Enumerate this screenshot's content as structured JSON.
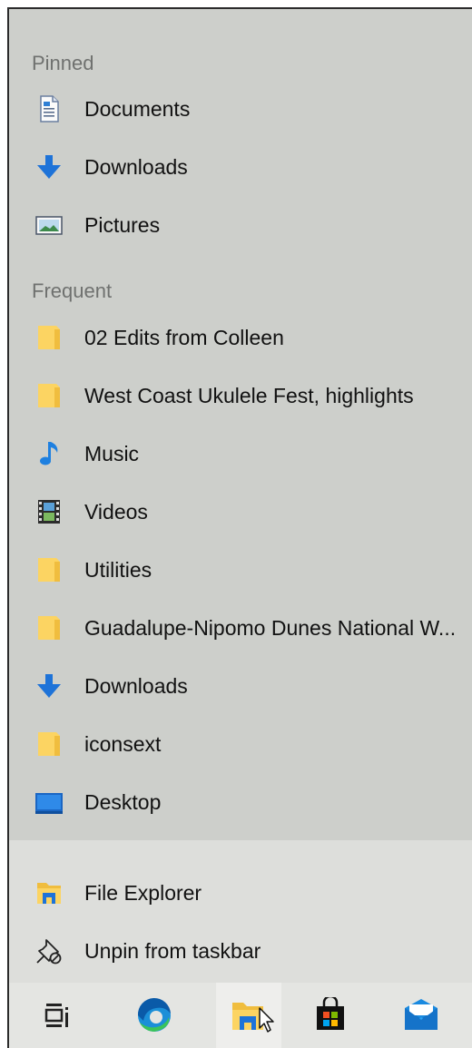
{
  "jumplist": {
    "pinned_header": "Pinned",
    "pinned": [
      {
        "label": "Documents",
        "icon": "documents-icon"
      },
      {
        "label": "Downloads",
        "icon": "downloads-icon"
      },
      {
        "label": "Pictures",
        "icon": "pictures-icon"
      }
    ],
    "frequent_header": "Frequent",
    "frequent": [
      {
        "label": "02 Edits from Colleen",
        "icon": "folder-icon"
      },
      {
        "label": "West Coast Ukulele Fest, highlights",
        "icon": "folder-icon"
      },
      {
        "label": "Music",
        "icon": "music-icon"
      },
      {
        "label": "Videos",
        "icon": "videos-icon"
      },
      {
        "label": "Utilities",
        "icon": "folder-icon"
      },
      {
        "label": "Guadalupe-Nipomo Dunes National W...",
        "icon": "folder-icon"
      },
      {
        "label": "Downloads",
        "icon": "downloads-icon"
      },
      {
        "label": "iconsext",
        "icon": "folder-icon"
      },
      {
        "label": "Desktop",
        "icon": "desktop-icon"
      }
    ],
    "tasks": [
      {
        "label": "File Explorer",
        "icon": "file-explorer-icon"
      },
      {
        "label": "Unpin from taskbar",
        "icon": "unpin-icon"
      }
    ]
  },
  "taskbar": {
    "buttons": [
      {
        "name": "task-view",
        "icon": "task-view-icon"
      },
      {
        "name": "edge",
        "icon": "edge-icon"
      },
      {
        "name": "file-explorer",
        "icon": "file-explorer-icon",
        "active": true
      },
      {
        "name": "microsoft-store",
        "icon": "store-icon"
      },
      {
        "name": "mail",
        "icon": "mail-icon"
      }
    ]
  },
  "colors": {
    "list_bg": "#cdcfcb",
    "tasks_bg": "#dddedb",
    "taskbar_bg": "#e4e5e2",
    "folder": "#fcd462",
    "accent_blue": "#1e73d8"
  }
}
